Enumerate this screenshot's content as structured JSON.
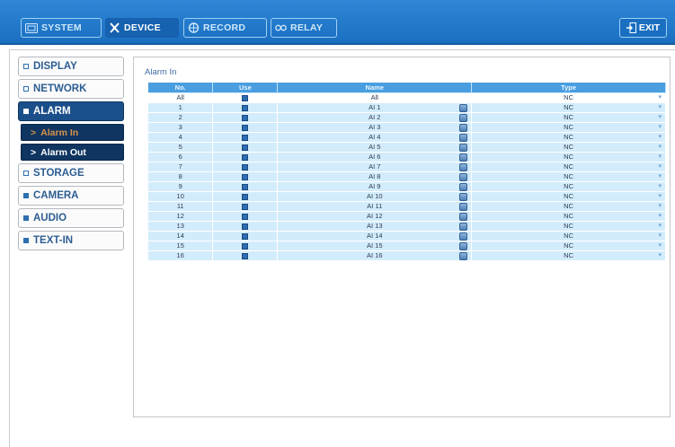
{
  "topbar": {
    "tabs": [
      {
        "id": "system",
        "label": "SYSTEM",
        "icon": "monitor-icon",
        "active": false
      },
      {
        "id": "device",
        "label": "DEVICE",
        "icon": "tools-icon",
        "active": true
      },
      {
        "id": "record",
        "label": "RECORD",
        "icon": "record-icon",
        "active": false
      },
      {
        "id": "relay",
        "label": "RELAY",
        "icon": "relay-icon",
        "active": false
      }
    ],
    "exit_label": "EXIT",
    "exit_icon": "exit-icon"
  },
  "sidebar": {
    "items": [
      {
        "label": "DISPLAY",
        "active": false
      },
      {
        "label": "NETWORK",
        "active": false
      },
      {
        "label": "ALARM",
        "active": true
      },
      {
        "label": "STORAGE",
        "active": false
      },
      {
        "label": "CAMERA",
        "active": false
      },
      {
        "label": "AUDIO",
        "active": false
      },
      {
        "label": "TEXT-IN",
        "active": false
      }
    ],
    "sub_items": [
      {
        "label": "Alarm In",
        "selected": true
      },
      {
        "label": "Alarm Out",
        "selected": false
      }
    ]
  },
  "panel": {
    "title": "Alarm In",
    "headers": {
      "no": "No.",
      "use": "Use",
      "name": "Name",
      "type": "Type"
    },
    "all_row": {
      "no": "All",
      "name": "All",
      "type": "NC"
    },
    "rows": [
      {
        "no": "1",
        "name": "AI 1",
        "type": "NC"
      },
      {
        "no": "2",
        "name": "AI 2",
        "type": "NC"
      },
      {
        "no": "3",
        "name": "AI 3",
        "type": "NC"
      },
      {
        "no": "4",
        "name": "AI 4",
        "type": "NC"
      },
      {
        "no": "5",
        "name": "AI 5",
        "type": "NC"
      },
      {
        "no": "6",
        "name": "AI 6",
        "type": "NC"
      },
      {
        "no": "7",
        "name": "AI 7",
        "type": "NC"
      },
      {
        "no": "8",
        "name": "AI 8",
        "type": "NC"
      },
      {
        "no": "9",
        "name": "AI 9",
        "type": "NC"
      },
      {
        "no": "10",
        "name": "AI 10",
        "type": "NC"
      },
      {
        "no": "11",
        "name": "AI 11",
        "type": "NC"
      },
      {
        "no": "12",
        "name": "AI 12",
        "type": "NC"
      },
      {
        "no": "13",
        "name": "AI 13",
        "type": "NC"
      },
      {
        "no": "14",
        "name": "AI 14",
        "type": "NC"
      },
      {
        "no": "15",
        "name": "AI 15",
        "type": "NC"
      },
      {
        "no": "16",
        "name": "AI 16",
        "type": "NC"
      }
    ]
  },
  "colors": {
    "accent": "#1a6fc1",
    "header": "#4a9ee0",
    "row": "#d3ecfb",
    "active_nav": "#1b4f8a"
  }
}
